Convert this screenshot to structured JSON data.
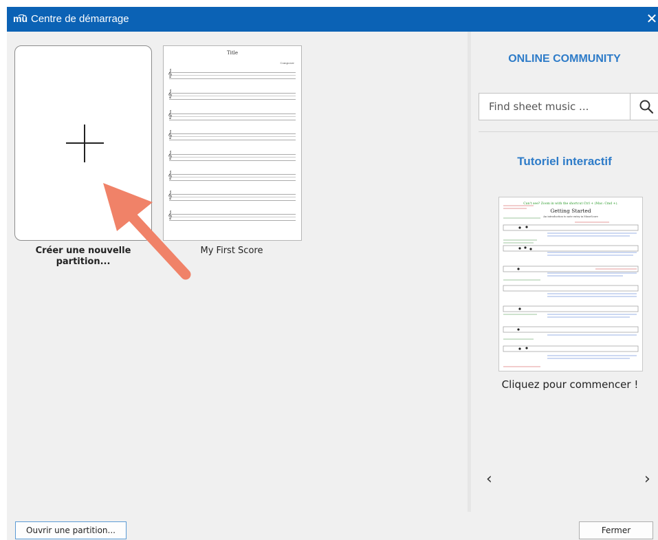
{
  "window": {
    "app_icon_text": "m͡ü",
    "title": "Centre de démarrage",
    "close_symbol": "✕"
  },
  "scores": {
    "new_label": "Créer une nouvelle partition...",
    "items": [
      {
        "label": "My First Score",
        "thumb_title": "Title",
        "thumb_composer": "Composer"
      }
    ]
  },
  "community": {
    "title": "ONLINE COMMUNITY",
    "search_placeholder": "Find sheet music ...",
    "search_icon": "search-icon"
  },
  "tutorial": {
    "title": "Tutoriel interactif",
    "thumb_header": "Can't see? Zoom in with the shortcut Ctrl + (Mac: Cmd +).",
    "thumb_heading": "Getting Started",
    "thumb_subheading": "An introduction to note entry in MuseScore",
    "caption": "Cliquez pour commencer !",
    "prev_symbol": "‹",
    "next_symbol": "›"
  },
  "footer": {
    "open_label": "Ouvrir une partition...",
    "close_label": "Fermer"
  },
  "colors": {
    "titlebar": "#0b62b5",
    "accent": "#2d7bc8",
    "arrow": "#f08268"
  }
}
